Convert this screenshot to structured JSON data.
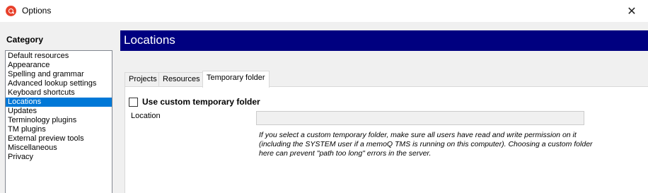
{
  "window": {
    "title": "Options",
    "close_glyph": "✕",
    "app_icon": "memoq-logo-icon"
  },
  "category": {
    "label": "Category",
    "items": [
      {
        "label": "Default resources",
        "selected": false
      },
      {
        "label": "Appearance",
        "selected": false
      },
      {
        "label": "Spelling and grammar",
        "selected": false
      },
      {
        "label": "Advanced lookup settings",
        "selected": false
      },
      {
        "label": "Keyboard shortcuts",
        "selected": false
      },
      {
        "label": "Locations",
        "selected": true
      },
      {
        "label": "Updates",
        "selected": false
      },
      {
        "label": "Terminology plugins",
        "selected": false
      },
      {
        "label": "TM plugins",
        "selected": false
      },
      {
        "label": "External preview tools",
        "selected": false
      },
      {
        "label": "Miscellaneous",
        "selected": false
      },
      {
        "label": "Privacy",
        "selected": false
      }
    ]
  },
  "header": {
    "title": "Locations",
    "background_color": "#000080"
  },
  "tabs": [
    {
      "label": "Projects",
      "active": false
    },
    {
      "label": "Resources",
      "active": false
    },
    {
      "label": "Temporary folder",
      "active": true
    }
  ],
  "temp_folder": {
    "checkbox_label": "Use custom temporary folder",
    "checked": false,
    "location_label": "Location",
    "location_value": "",
    "info_text": "If you select a custom temporary folder, make sure all users have read and write permission on it (including the SYSTEM user if a memoQ TMS is running on this computer). Choosing a custom folder here can prevent \"path too long\" errors in the server."
  },
  "colors": {
    "selection": "#0078d7",
    "header": "#000080"
  }
}
